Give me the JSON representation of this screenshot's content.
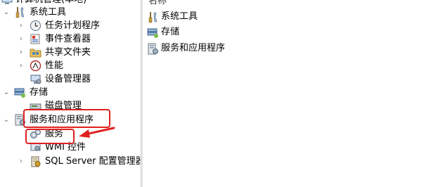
{
  "tree": {
    "root_label": "计算机管理(本地)",
    "system_tools": {
      "label": "系统工具",
      "children": [
        "任务计划程序",
        "事件查看器",
        "共享文件夹",
        "性能",
        "设备管理器"
      ]
    },
    "storage": {
      "label": "存储",
      "children": [
        "磁盘管理"
      ]
    },
    "services_apps": {
      "label": "服务和应用程序",
      "children": [
        "服务",
        "WMI 控件",
        "SQL Server 配置管理器"
      ]
    }
  },
  "content": {
    "column_header": "名称",
    "items": [
      "系统工具",
      "存储",
      "服务和应用程序"
    ]
  },
  "icons": {
    "tools": "tools-icon",
    "clock": "task-scheduler-icon",
    "event": "event-viewer-icon",
    "share": "shared-folder-icon",
    "perf": "performance-icon",
    "device": "device-manager-icon",
    "storage": "storage-icon",
    "disk": "disk-icon",
    "services_apps": "services-apps-icon",
    "gear": "services-icon",
    "wmi": "wmi-icon",
    "sql": "sql-server-icon"
  },
  "annotation_color": "#e02020"
}
